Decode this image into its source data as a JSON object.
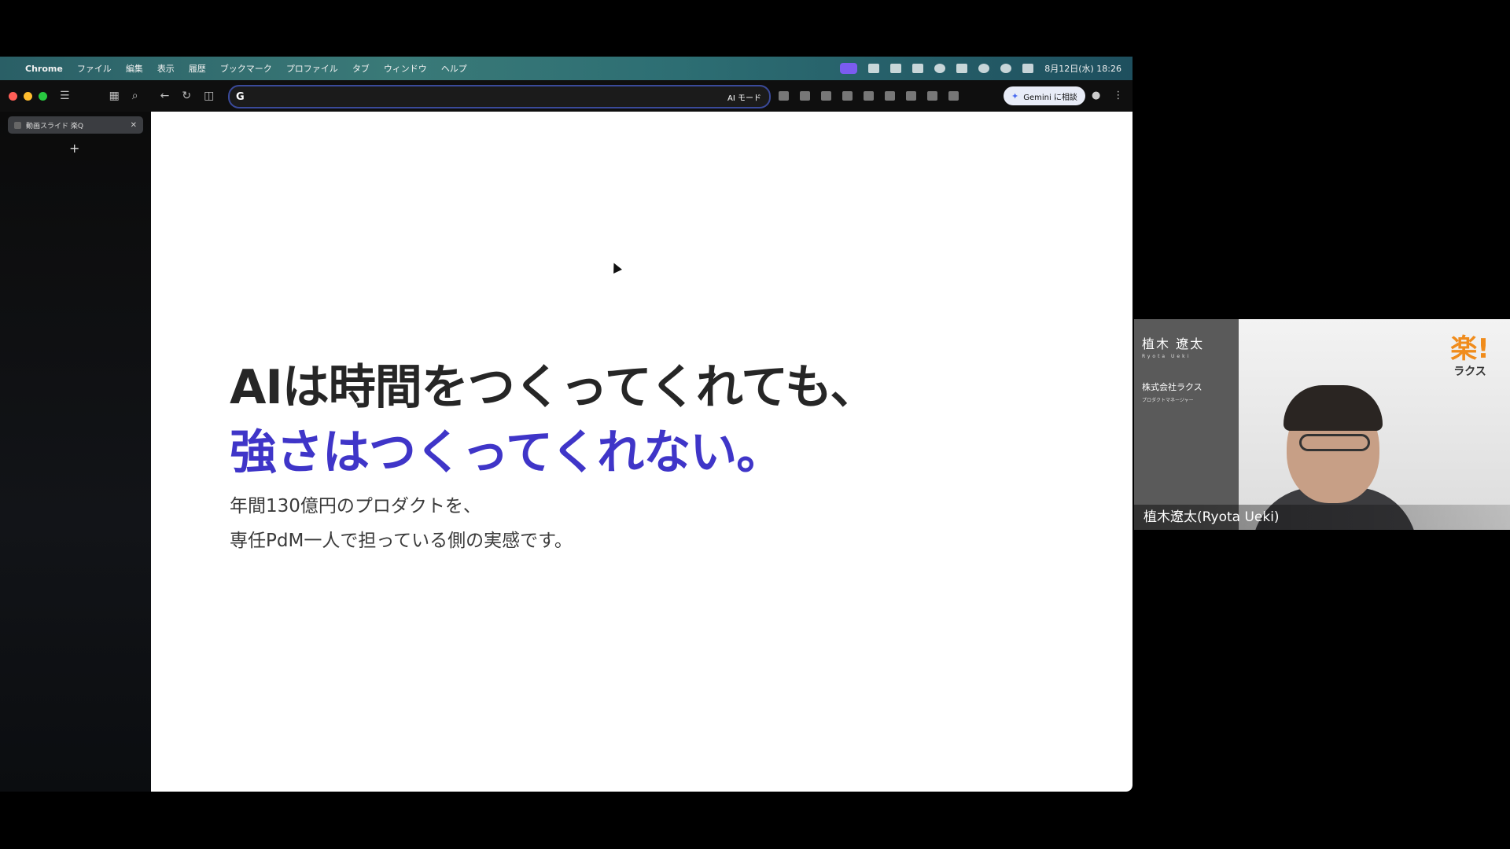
{
  "menubar": {
    "app": "Chrome",
    "items": [
      "ファイル",
      "編集",
      "表示",
      "履歴",
      "ブックマーク",
      "プロファイル",
      "タブ",
      "ウィンドウ",
      "ヘルプ"
    ],
    "datetime": "8月12日(水) 18:26"
  },
  "browser": {
    "tab_title": "動画スライド 楽Q",
    "omnibox_value": "",
    "ai_mode_label": "AI モード",
    "gemini_label": "Gemini に相談",
    "accent_color": "#3f35c8"
  },
  "slide": {
    "headline_line1": "AIは時間をつくってくれても、",
    "headline_line2": "強さはつくってくれない。",
    "body_line1": "年間130億円のプロダクトを、",
    "body_line2": "専任PdM一人で担っている側の実感です。"
  },
  "speaker": {
    "name_jp": "植木 遼太",
    "name_romaji": "Ryota Ueki",
    "company": "株式会社ラクス",
    "role": "プロダクトマネージャー",
    "logo_big": "楽!",
    "logo_small": "ラクス",
    "video_label": "植木遼太(Ryota Ueki)"
  }
}
